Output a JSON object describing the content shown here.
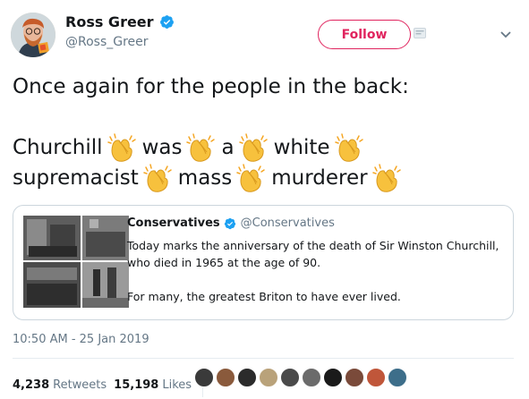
{
  "tweet": {
    "author": {
      "display_name": "Ross Greer",
      "handle": "@Ross_Greer",
      "verified": true
    },
    "follow_label": "Follow",
    "text_lines": [
      [
        "Once again for the people in the back:"
      ],
      [],
      [
        "Churchill",
        "clap",
        "was",
        "clap",
        "a",
        "clap",
        "white",
        "clap"
      ],
      [
        "supremacist",
        "clap",
        "mass",
        "clap",
        "murderer",
        "clap"
      ]
    ],
    "timestamp": "10:50 AM - 25 Jan 2019",
    "retweets_count": "4,238",
    "retweets_label": "Retweets",
    "likes_count": "15,198",
    "likes_label": "Likes"
  },
  "quoted": {
    "display_name": "Conservatives",
    "handle": "@Conservatives",
    "verified": true,
    "text_line1": "Today marks the anniversary of the death of Sir Winston Churchill,",
    "text_line2": "who died in 1965 at the age of 90.",
    "text_line3": "For many, the greatest Briton to have ever lived."
  },
  "icons": {
    "verified": "verified-badge-icon",
    "menu": "chevron-down-icon",
    "clap": "clapping-hands-emoji"
  },
  "colors": {
    "accent": "#e0245e",
    "verified": "#1da1f2",
    "secondary_text": "#657786",
    "border": "#ccd6dd",
    "clap": "#f7c13d"
  },
  "likers": [
    "#3a3a3a",
    "#8a5a3c",
    "#2b2b2b",
    "#b9a27a",
    "#4a4a4a",
    "#6b6b6b",
    "#1a1a1a",
    "#7a4a3a",
    "#c0563a",
    "#3d6e8a"
  ]
}
